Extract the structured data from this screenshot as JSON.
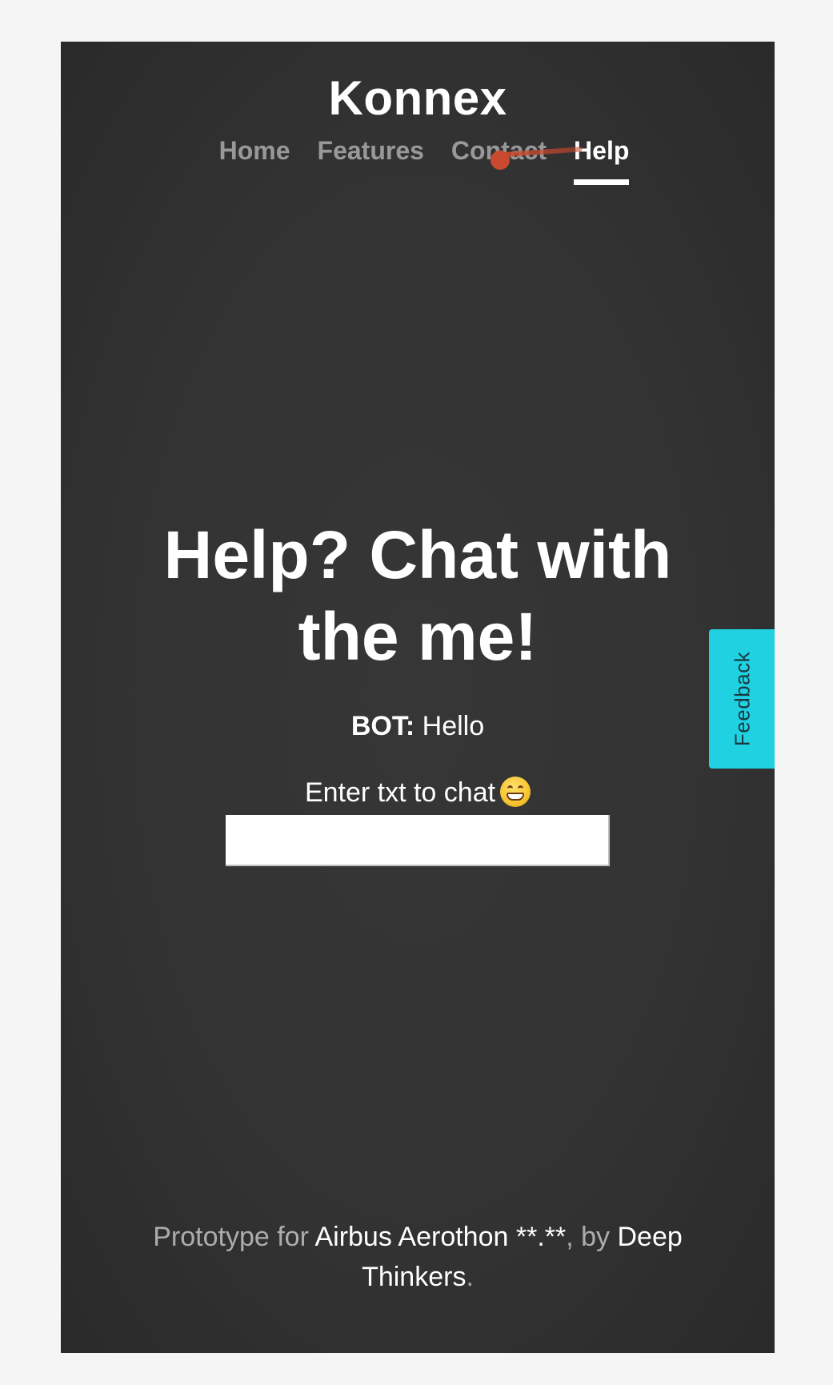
{
  "header": {
    "brand": "Konnex",
    "nav": {
      "home": "Home",
      "features": "Features",
      "contact": "Contact",
      "help": "Help"
    }
  },
  "main": {
    "headline_line1": "Help? Chat with",
    "headline_line2": "the me!",
    "bot_label": "BOT:",
    "bot_message": "Hello",
    "chat_prompt": "Enter txt to chat",
    "chat_input_value": ""
  },
  "feedback": {
    "label": "Feedback"
  },
  "footer": {
    "prefix": "Prototype for ",
    "event_link": "Airbus Aerothon **.**",
    "middle": ", by ",
    "team_link": "Deep Thinkers",
    "suffix": "."
  },
  "colors": {
    "background": "#333333",
    "feedback_tab": "#1fd1e1",
    "cursor_trail": "#c94a2e"
  }
}
